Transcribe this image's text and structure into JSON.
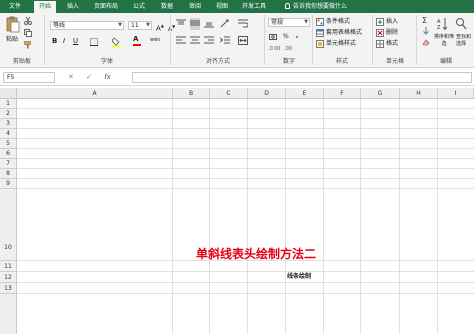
{
  "tabs": [
    "文件",
    "开始",
    "插入",
    "页面布局",
    "公式",
    "数据",
    "审阅",
    "视图",
    "开发工具"
  ],
  "tell_me": "告诉我你想要做什么",
  "clipboard": {
    "paste_label": "粘贴",
    "group_label": "剪贴板"
  },
  "font": {
    "name": "等线",
    "size": "11",
    "bold": "B",
    "italic": "I",
    "underline": "U",
    "grow": "A",
    "shrink": "A",
    "font_color": "A",
    "phonetic": "wén",
    "group_label": "字体"
  },
  "alignment": {
    "group_label": "对齐方式"
  },
  "number": {
    "format": "常规",
    "currency": "%",
    "comma": ",",
    "group_label": "数字"
  },
  "styles": {
    "conditional": "条件格式",
    "table": "套用表格格式",
    "cell": "单元格样式",
    "group_label": "样式"
  },
  "cells": {
    "insert": "插入",
    "delete": "删除",
    "format": "格式",
    "group_label": "单元格"
  },
  "editing": {
    "sigma": "Σ",
    "sort": "排序和筛选",
    "find": "查找和选择",
    "group_label": "编辑"
  },
  "formula_bar": {
    "name_box": "F5",
    "cancel": "✕",
    "enter": "✓",
    "fx": "fx",
    "value": ""
  },
  "columns": [
    "A",
    "B",
    "C",
    "D",
    "E",
    "F",
    "G",
    "H",
    "I"
  ],
  "rows": [
    "1",
    "2",
    "3",
    "4",
    "5",
    "6",
    "7",
    "8",
    "9",
    "10",
    "11",
    "12",
    "13"
  ],
  "cell_content": {
    "title": "单斜线表头绘制方法二",
    "subtitle": "线条绘制"
  },
  "colors": {
    "ribbon_tab": "#217346",
    "title_red": "#e60012"
  }
}
